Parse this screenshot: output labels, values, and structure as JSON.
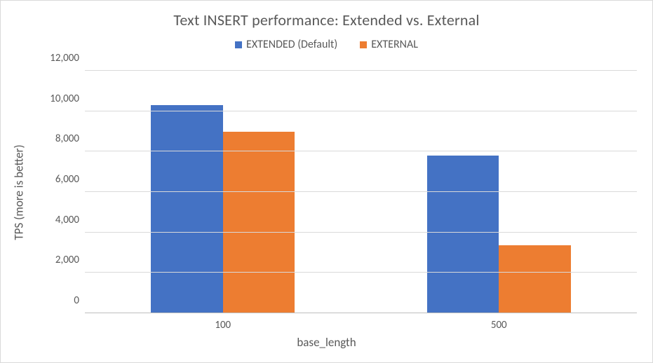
{
  "chart_data": {
    "type": "bar",
    "title": "Text INSERT performance: Extended vs. External",
    "xlabel": "base_length",
    "ylabel": "TPS (more is better)",
    "ylim": [
      0,
      12000
    ],
    "yticks": [
      0,
      2000,
      4000,
      6000,
      8000,
      10000,
      12000
    ],
    "ytick_labels": [
      "0",
      "2,000",
      "4,000",
      "6,000",
      "8,000",
      "10,000",
      "12,000"
    ],
    "categories": [
      "100",
      "500"
    ],
    "series": [
      {
        "name": "EXTENDED (Default)",
        "color": "#4472c4",
        "values": [
          10300,
          7800
        ]
      },
      {
        "name": "EXTERNAL",
        "color": "#ed7d31",
        "values": [
          9000,
          3350
        ]
      }
    ]
  }
}
